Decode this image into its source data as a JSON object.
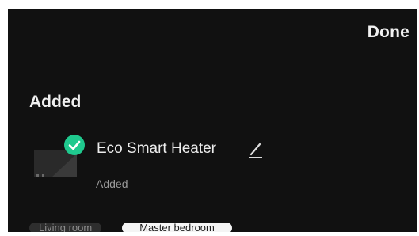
{
  "header": {
    "done_label": "Done"
  },
  "section": {
    "title": "Added"
  },
  "device": {
    "icon": "heater-thumbnail",
    "status_icon": "check-circle-icon",
    "name": "Eco Smart Heater",
    "status": "Added"
  },
  "rooms": [
    {
      "label": "Living room",
      "selected": false
    },
    {
      "label": "Master bedroom",
      "selected": true
    }
  ],
  "colors": {
    "background": "#111111",
    "accent_green": "#1fc98e",
    "text_primary": "#f0f0f0",
    "text_secondary": "#9a9a9a"
  }
}
